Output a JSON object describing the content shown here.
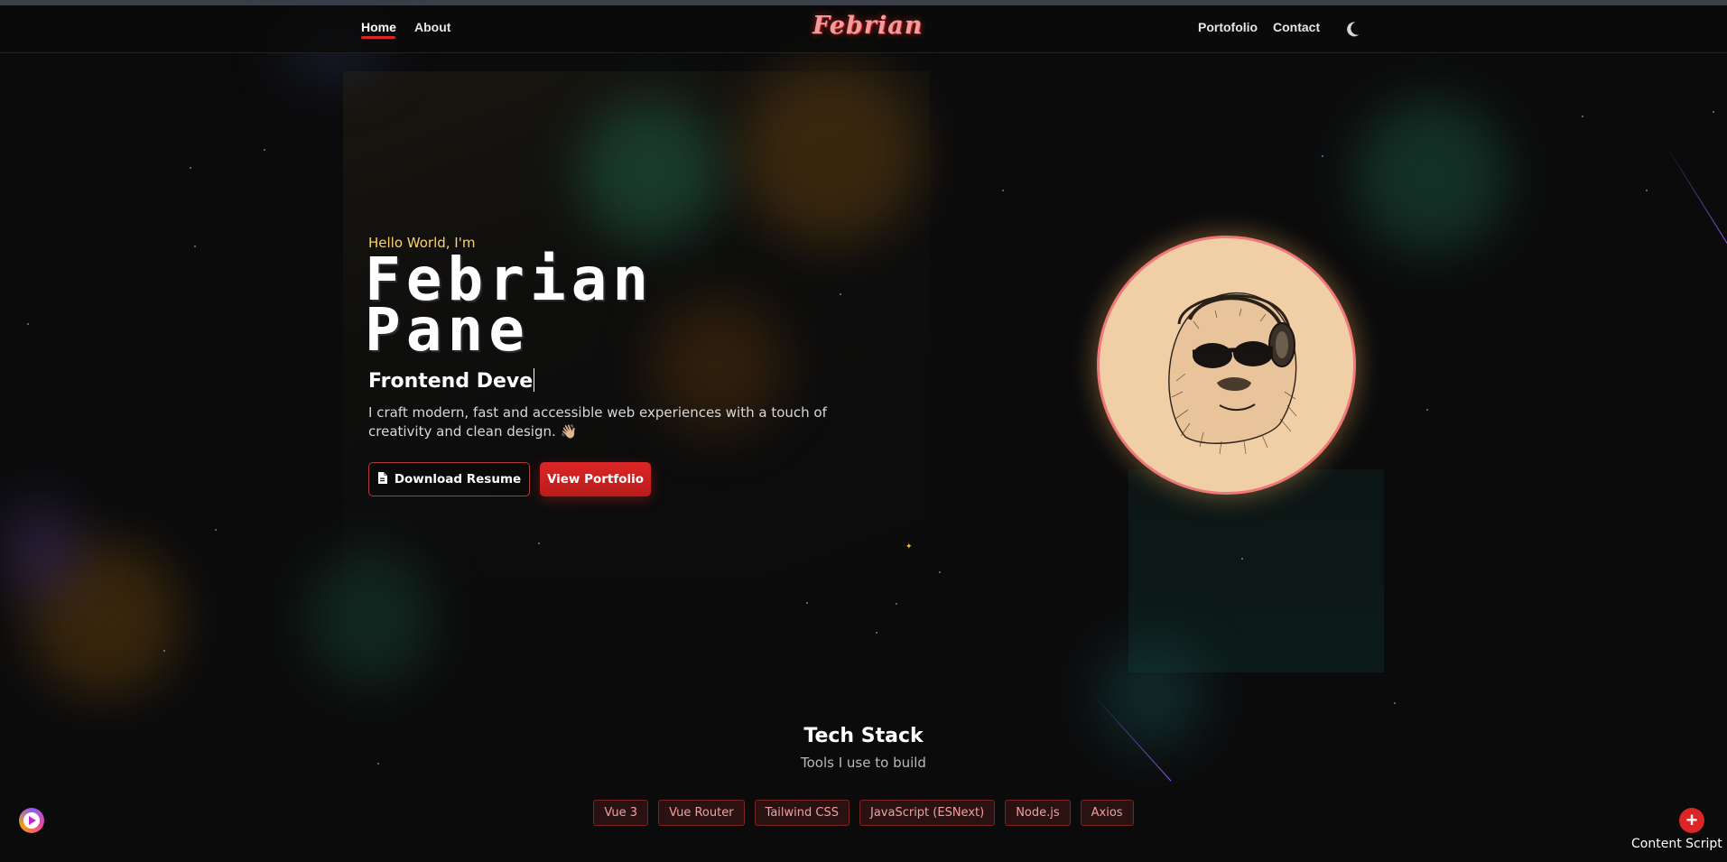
{
  "nav": {
    "left": [
      {
        "label": "Home",
        "active": true
      },
      {
        "label": "About"
      }
    ],
    "right": [
      {
        "label": "Portofolio"
      },
      {
        "label": "Contact"
      }
    ],
    "logo": "Febrian",
    "theme_icon": "moon-icon"
  },
  "hero": {
    "greeting": "Hello World, I'm",
    "name_line1": "Febrian",
    "name_line2": "Pane",
    "role_typed": "Frontend Deve",
    "description": "I craft modern, fast and accessible web experiences with a touch of creativity and clean design. 👋🏼",
    "resume_button": "Download Resume",
    "resume_icon": "document-icon",
    "portfolio_button": "View Portfolio",
    "avatar": "gorilla-with-headphones-illustration"
  },
  "tech": {
    "title": "Tech Stack",
    "subtitle": "Tools I use to build",
    "items": [
      "Vue 3",
      "Vue Router",
      "Tailwind CSS",
      "JavaScript (ESNext)",
      "Node.js",
      "Axios"
    ]
  },
  "widgets": {
    "play_icon": "play-icon",
    "add_icon": "plus-icon",
    "content_script_label": "Content Script"
  },
  "colors": {
    "accent": "#dc2626",
    "greeting": "#fbd26a",
    "logo": "#f29c9c",
    "background": "#0b0b0c"
  }
}
